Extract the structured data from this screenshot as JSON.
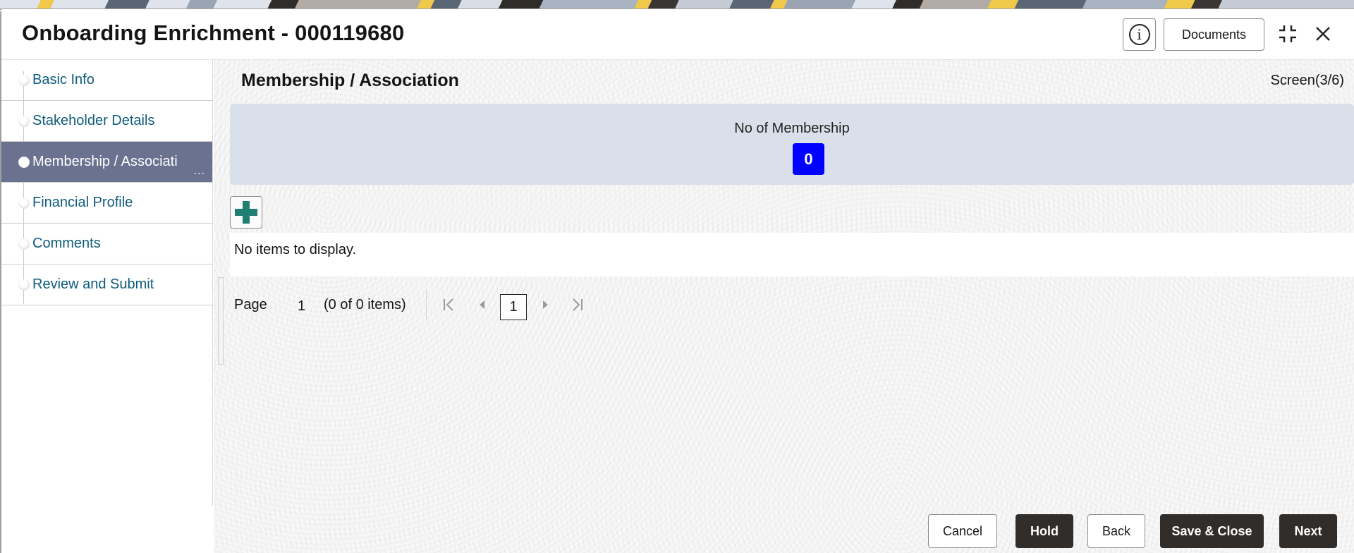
{
  "window": {
    "title": "Onboarding Enrichment - 000119680",
    "documents_label": "Documents",
    "icons": {
      "info": "info-circle-icon",
      "minimize": "minimize-icon",
      "close": "close-icon"
    }
  },
  "sidebar": {
    "items": [
      {
        "label": "Basic Info",
        "active": false
      },
      {
        "label": "Stakeholder Details",
        "active": false
      },
      {
        "label": "Membership / Associati",
        "active": true,
        "overflow": "..."
      },
      {
        "label": "Financial Profile",
        "active": false
      },
      {
        "label": "Comments",
        "active": false
      },
      {
        "label": "Review and Submit",
        "active": false
      }
    ]
  },
  "main": {
    "section_title": "Membership / Association",
    "screen_indicator": "Screen(3/6)",
    "summary": {
      "label": "No of Membership",
      "count": "0"
    },
    "add_icon": "plus-icon",
    "empty_message": "No items to display.",
    "pagination": {
      "page_label": "Page",
      "page_number": "1",
      "item_count": "(0 of 0 items)",
      "current_page": "1"
    }
  },
  "footer": {
    "cancel_label": "Cancel",
    "hold_label": "Hold",
    "back_label": "Back",
    "save_close_label": "Save & Close",
    "next_label": "Next"
  },
  "colors": {
    "active_nav_bg": "#6b7290",
    "nav_link": "#0f5b7c",
    "count_badge": "#0000ff",
    "summary_bg": "#d9e0ea",
    "primary_button": "#312d2a",
    "add_icon": "#1f7f73"
  }
}
